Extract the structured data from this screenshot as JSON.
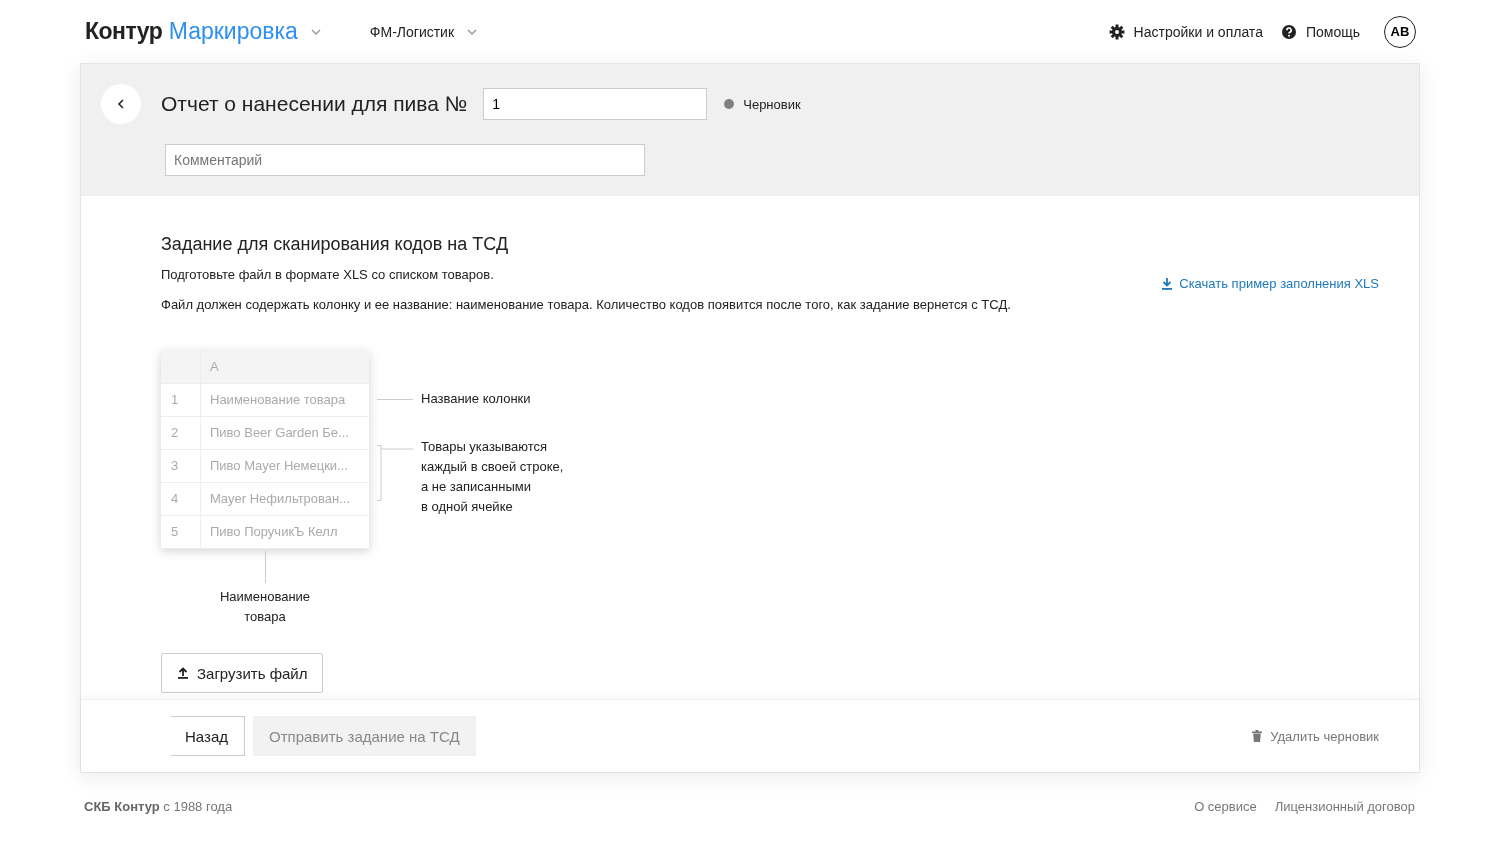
{
  "header": {
    "brand": "Контур",
    "product": "Маркировка",
    "org": "ФМ-Логистик",
    "settings": "Настройки и оплата",
    "help": "Помощь",
    "avatar": "АВ"
  },
  "document": {
    "title": "Отчет о нанесении для пива №",
    "number": "1",
    "status": "Черновик",
    "comment_placeholder": "Комментарий"
  },
  "task": {
    "heading": "Задание для сканирования кодов на ТСД",
    "lines": [
      "Подготовьте файл в формате XLS со списком товаров.",
      "Файл должен содержать колонку и ее название: наименование товара. Количество кодов появится после того, как задание вернется с ТСД."
    ],
    "download_link": "Скачать пример заполнения XLS"
  },
  "example": {
    "column": "A",
    "rows": [
      {
        "num": "1",
        "value": "Наименование товара"
      },
      {
        "num": "2",
        "value": "Пиво Beer Garden Бе..."
      },
      {
        "num": "3",
        "value": "Пиво Mayer Немецки..."
      },
      {
        "num": "4",
        "value": "Mayer Нефильтрован..."
      },
      {
        "num": "5",
        "value": "Пиво ПоручикЪ Келл"
      }
    ],
    "note_header": "Название колонки",
    "note_rows": "Товары указываются\nкаждый в своей строке,\nа не записанными\nв одной ячейке",
    "note_column": "Наименование\nтовара"
  },
  "upload_button": "Загрузить файл",
  "actions": [
    {
      "label": "Назад",
      "kind": "back",
      "disabled": false
    },
    {
      "label": "Отправить задание на ТСД",
      "kind": "primary",
      "disabled": true
    }
  ],
  "delete_link": "Удалить черновик",
  "footer": {
    "copyright": "**СКБ Контур** с 1988 года",
    "links": [
      "О сервисе",
      "Лицензионный договор"
    ]
  }
}
